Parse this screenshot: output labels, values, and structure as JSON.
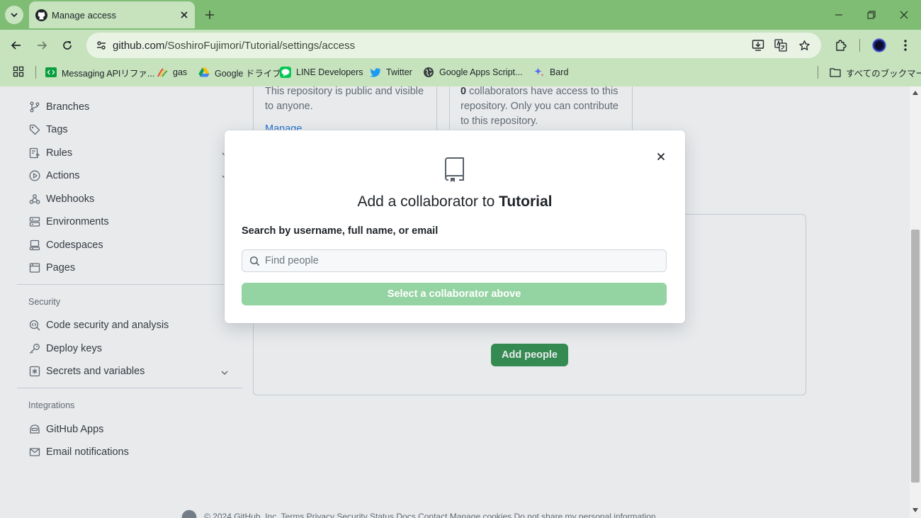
{
  "browser": {
    "tab": {
      "title": "Manage access"
    },
    "address_bar": {
      "url_host": "github.com",
      "url_path": "/SoshiroFujimori/Tutorial/settings/access"
    },
    "bookmarks": [
      {
        "label": "Messaging APIリファ...",
        "icon": "code-icon"
      },
      {
        "label": "gas",
        "icon": "rainbow-icon"
      },
      {
        "label": "Google ドライブ",
        "icon": "google-drive-icon"
      },
      {
        "label": "LINE Developers",
        "icon": "line-icon"
      },
      {
        "label": "Twitter",
        "icon": "twitter-icon"
      },
      {
        "label": "Google Apps Script...",
        "icon": "globe-icon"
      },
      {
        "label": "Bard",
        "icon": "bard-sparkle-icon"
      }
    ],
    "all_bookmarks_label": "すべてのブックマーク",
    "accent_color": "#7fbd74"
  },
  "sidebar": {
    "items": [
      {
        "label": "Branches",
        "icon": "branch-icon"
      },
      {
        "label": "Tags",
        "icon": "tag-icon"
      },
      {
        "label": "Rules",
        "icon": "rules-icon"
      },
      {
        "label": "Actions",
        "icon": "play-icon"
      },
      {
        "label": "Webhooks",
        "icon": "webhook-icon"
      },
      {
        "label": "Environments",
        "icon": "server-icon"
      },
      {
        "label": "Codespaces",
        "icon": "codespaces-icon"
      },
      {
        "label": "Pages",
        "icon": "browser-icon"
      }
    ],
    "security": {
      "heading": "Security",
      "items": [
        {
          "label": "Code security and analysis",
          "icon": "codescan-icon"
        },
        {
          "label": "Deploy keys",
          "icon": "key-icon"
        },
        {
          "label": "Secrets and variables",
          "icon": "asterisk-icon"
        }
      ]
    },
    "integrations": {
      "heading": "Integrations",
      "items": [
        {
          "label": "GitHub Apps",
          "icon": "hubot-icon"
        },
        {
          "label": "Email notifications",
          "icon": "mail-icon"
        }
      ]
    }
  },
  "main": {
    "visibility_card": {
      "text": "This repository is public and visible to anyone.",
      "link": "Manage"
    },
    "access_card": {
      "count": "0",
      "text": " collaborators have access to this repository. Only you can contribute to this repository."
    },
    "add_people_button": "Add people",
    "footer": "© 2024 GitHub, Inc.   Terms   Privacy   Security   Status   Docs   Contact   Manage cookies   Do not share my personal information"
  },
  "modal": {
    "title_prefix": "Add a collaborator to ",
    "repo_name": "Tutorial",
    "search_label": "Search by username, full name, or email",
    "search_placeholder": "Find people",
    "search_value": "",
    "submit_label": "Select a collaborator above",
    "primary_color": "#1f883d",
    "disabled_color": "#94d3a2"
  }
}
